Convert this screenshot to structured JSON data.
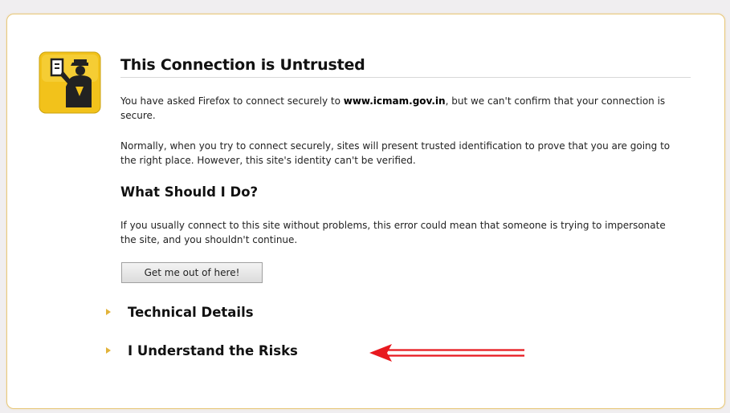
{
  "page": {
    "title": "This Connection is Untrusted",
    "intro_prefix": "You have asked Firefox to connect securely to ",
    "intro_host": "www.icmam.gov.in",
    "intro_suffix": ", but we can't confirm that your connection is secure.",
    "normally_text": "Normally, when you try to connect securely, sites will present trusted identification to prove that you are going to the right place. However, this site's identity can't be verified.",
    "what_heading": "What Should I Do?",
    "what_text": "If you usually connect to this site without problems, this error could mean that someone is trying to impersonate the site, and you shouldn't continue.",
    "get_out_button": "Get me out of here!",
    "technical_details_label": "Technical Details",
    "understand_risks_label": "I Understand the Risks"
  },
  "icons": {
    "policeman": "policeman-icon",
    "expander": "triangle-right-icon",
    "annotation": "red-arrow-icon"
  },
  "colors": {
    "icon_yellow": "#f2c21b",
    "panel_border": "#e8c87a",
    "triangle": "#e2b33a",
    "arrow_red": "#e8191f"
  }
}
